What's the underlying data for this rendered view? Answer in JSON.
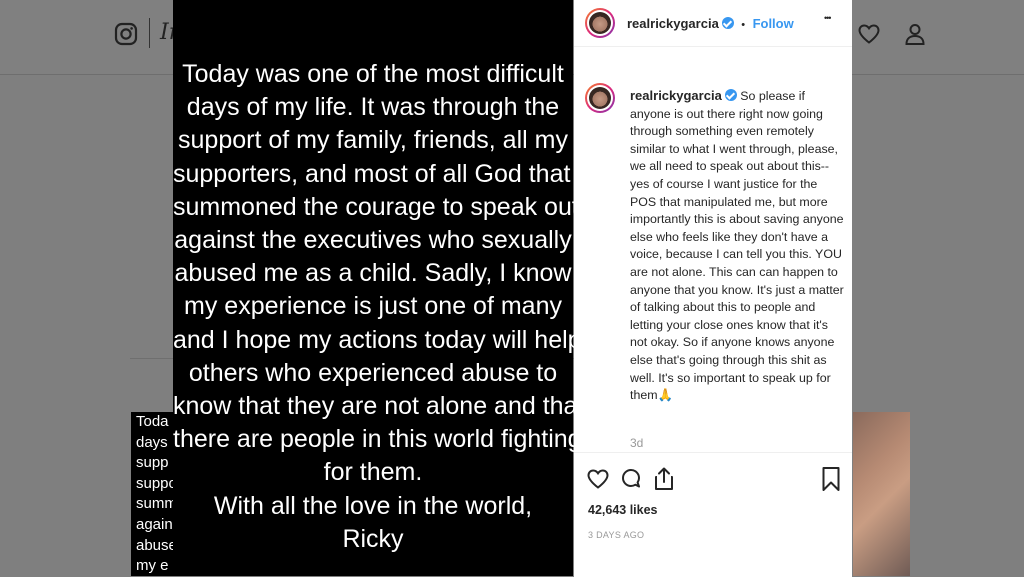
{
  "nav": {
    "wordmark_fragment": "In",
    "icons": [
      "instagram-logo-icon",
      "heart-icon",
      "profile-icon"
    ]
  },
  "post_image": {
    "lines": [
      "Today was one of the most difficult",
      "days of my life. It was through the",
      "support of my family, friends, all my",
      "supporters, and most of all God that I",
      "summoned the courage to speak out",
      "against the executives who sexually",
      "abused me as a child. Sadly, I know",
      "my experience is just one of many",
      "and I hope my actions today will help",
      "others who experienced abuse to",
      "know that they are not alone and that",
      "there are people in this world fighting",
      "for them.",
      "With all the love in the world,",
      "Ricky"
    ]
  },
  "background_thumb": {
    "lines": [
      "Toda",
      "days",
      "supp",
      "suppo",
      "summ",
      "again",
      "abuse",
      "my e"
    ]
  },
  "panel": {
    "header": {
      "username": "realrickygarcia",
      "separator": "•",
      "follow_label": "Follow",
      "more_label": "•••"
    },
    "caption": {
      "username": "realrickygarcia",
      "text": "So please if anyone is out there right now going through something even remotely similar to what I went through, please, we all need to speak out about this-- yes of course I want justice for the POS that manipulated me, but more importantly this is about saving anyone else who feels like they don't have a voice, because I can tell you this. YOU are not alone. This can can happen to anyone that you know. It's just a matter of talking about this to people and letting your close ones know that it's not okay. So if anyone knows anyone else that's going through this shit as well. It's so important to speak up for them",
      "emoji": "🙏",
      "time": "3d"
    },
    "actions": {
      "likes": "42,643 likes",
      "posted": "3 DAYS AGO"
    }
  }
}
